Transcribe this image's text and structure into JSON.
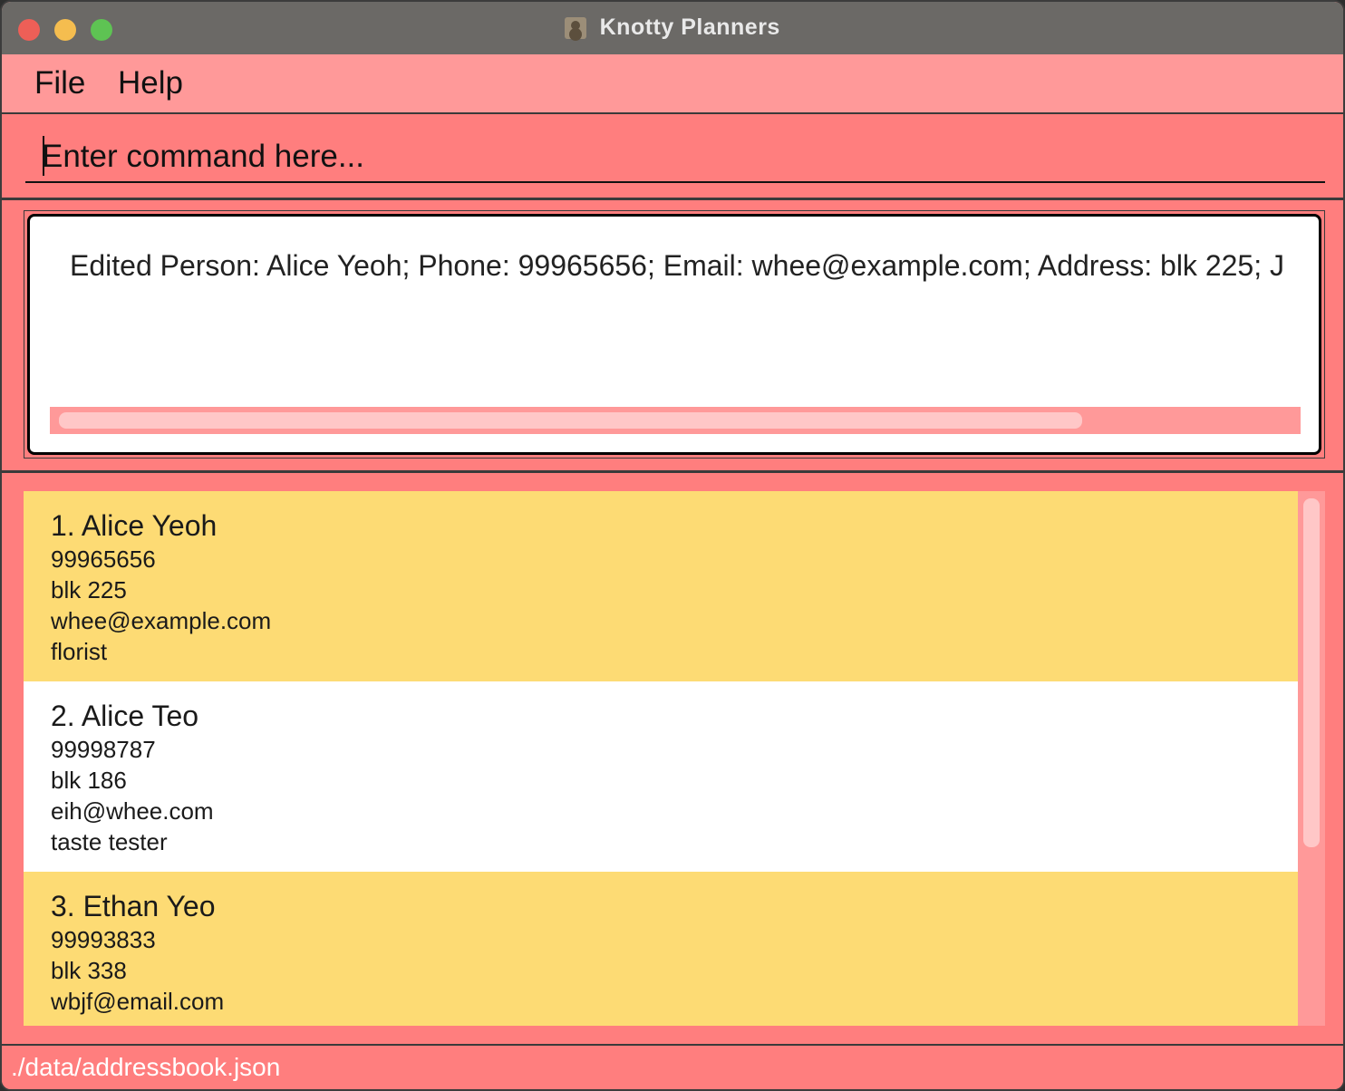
{
  "window": {
    "title": "Knotty Planners"
  },
  "menu": {
    "items": [
      {
        "label": "File"
      },
      {
        "label": "Help"
      }
    ]
  },
  "command": {
    "placeholder": "Enter command here...",
    "value": ""
  },
  "result": {
    "text": "Edited Person: Alice Yeoh; Phone: 99965656; Email: whee@example.com; Address: blk 225; J",
    "horizontal_scroll_fraction": 0.83
  },
  "persons": [
    {
      "index_name": "1. Alice Yeoh",
      "phone": "99965656",
      "address": "blk 225",
      "email": "whee@example.com",
      "job": "florist"
    },
    {
      "index_name": "2. Alice Teo",
      "phone": "99998787",
      "address": "blk 186",
      "email": "eih@whee.com",
      "job": "taste tester"
    },
    {
      "index_name": "3. Ethan Yeo",
      "phone": "99993833",
      "address": "blk 338",
      "email": "wbjf@email.com",
      "job": ""
    }
  ],
  "list_scroll": {
    "visible_fraction": 0.67
  },
  "status": {
    "file_path": "./data/addressbook.json"
  },
  "colors": {
    "menu_bar": "#ff9999",
    "background": "#ff7e7e",
    "card_odd": "#fddb74",
    "card_even": "#ffffff"
  },
  "icons": {
    "close": "close-icon",
    "minimize": "minimize-icon",
    "zoom": "zoom-icon",
    "app": "address-book-icon"
  }
}
